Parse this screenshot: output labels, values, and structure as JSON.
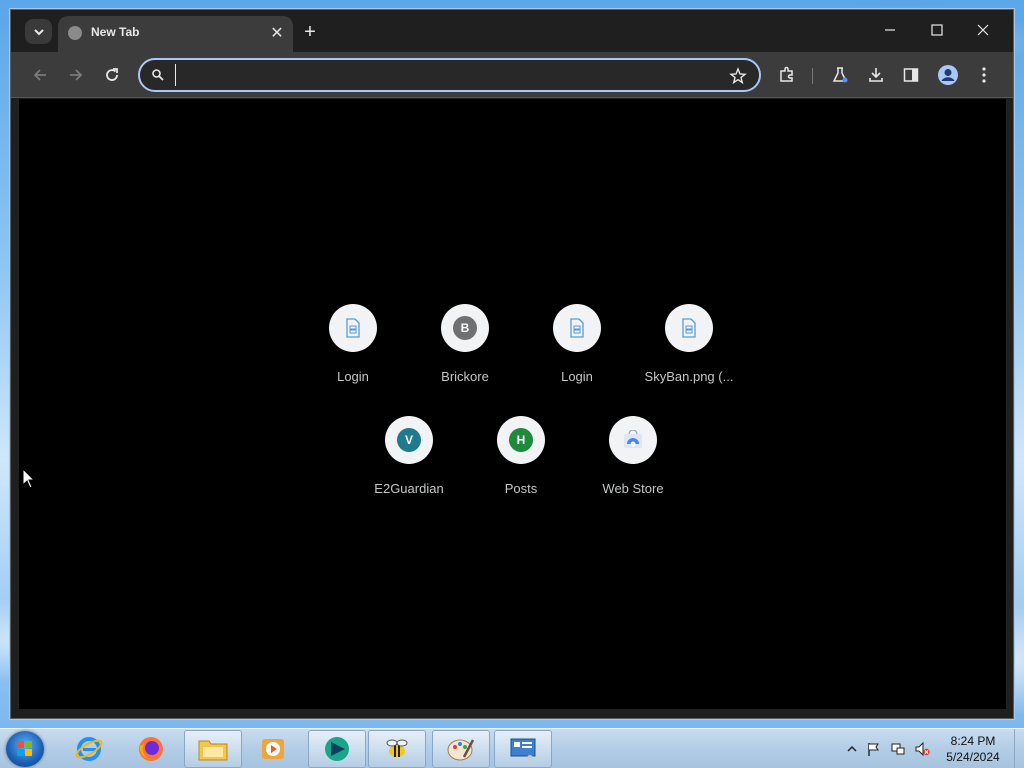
{
  "browser": {
    "tab": {
      "title": "New Tab"
    },
    "omnibox": {
      "value": "",
      "placeholder": ""
    },
    "accent_color": "#a8c7fa"
  },
  "shortcuts": [
    {
      "label": "Login",
      "icon": "page-icon",
      "letter": ""
    },
    {
      "label": "Brickore",
      "icon": "letter-icon",
      "letter": "B",
      "color": "#6e7073"
    },
    {
      "label": "Login",
      "icon": "page-icon",
      "letter": ""
    },
    {
      "label": "SkyBan.png (...",
      "icon": "page-icon",
      "letter": ""
    },
    {
      "label": "E2Guardian",
      "icon": "letter-icon",
      "letter": "V",
      "color": "#1f7a8c"
    },
    {
      "label": "Posts",
      "icon": "letter-icon",
      "letter": "H",
      "color": "#1e8a3c"
    },
    {
      "label": "Web Store",
      "icon": "web-store-icon",
      "letter": ""
    }
  ],
  "taskbar": {
    "apps": [
      {
        "name": "internet-explorer-icon"
      },
      {
        "name": "firefox-icon"
      },
      {
        "name": "file-explorer-icon"
      },
      {
        "name": "media-player-icon"
      },
      {
        "name": "browser-app-icon"
      },
      {
        "name": "bee-app-icon"
      },
      {
        "name": "paint-icon"
      },
      {
        "name": "control-panel-icon"
      }
    ],
    "clock": {
      "time": "8:24 PM",
      "date": "5/24/2024"
    }
  }
}
